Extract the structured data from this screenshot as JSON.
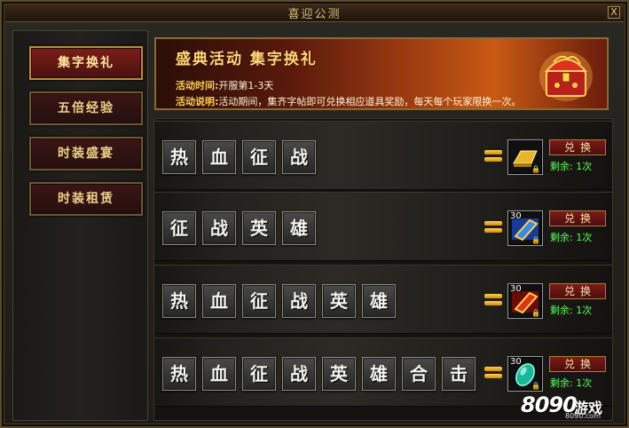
{
  "window": {
    "title": "喜迎公测",
    "close_label": "X"
  },
  "sidebar": {
    "items": [
      {
        "label": "集字换礼",
        "active": true
      },
      {
        "label": "五倍经验",
        "active": false
      },
      {
        "label": "时装盛宴",
        "active": false
      },
      {
        "label": "时装租赁",
        "active": false
      }
    ]
  },
  "banner": {
    "title": "盛典活动 集字换礼",
    "time_label": "活动时间:",
    "time_value": "开服第1-3天",
    "desc_label": "活动说明:",
    "desc_value": "活动期间，集齐字帖即可兑换相应道具奖励，每天每个玩家限换一次。"
  },
  "rows": [
    {
      "chars": [
        "热",
        "血",
        "征",
        "战"
      ],
      "reward_icon": "gold-bar-icon",
      "reward_count": "",
      "button": "兑换",
      "remain": "剩余: 1次",
      "colors": {
        "reward": "#d8a21a"
      }
    },
    {
      "chars": [
        "征",
        "战",
        "英",
        "雄"
      ],
      "reward_icon": "blue-scroll-icon",
      "reward_count": "30",
      "button": "兑换",
      "remain": "剩余: 1次",
      "colors": {
        "reward": "#2c6fd8"
      }
    },
    {
      "chars": [
        "热",
        "血",
        "征",
        "战",
        "英",
        "雄"
      ],
      "reward_icon": "red-scroll-icon",
      "reward_count": "30",
      "button": "兑换",
      "remain": "剩余: 1次",
      "colors": {
        "reward": "#c8261a"
      }
    },
    {
      "chars": [
        "热",
        "血",
        "征",
        "战",
        "英",
        "雄",
        "合",
        "击"
      ],
      "reward_icon": "teal-gem-icon",
      "reward_count": "30",
      "button": "兑换",
      "remain": "剩余: 1次",
      "colors": {
        "reward": "#2ad0b0"
      }
    }
  ],
  "watermark": {
    "number": "8090",
    "brand": "游戏",
    "domain": "8090.com"
  }
}
